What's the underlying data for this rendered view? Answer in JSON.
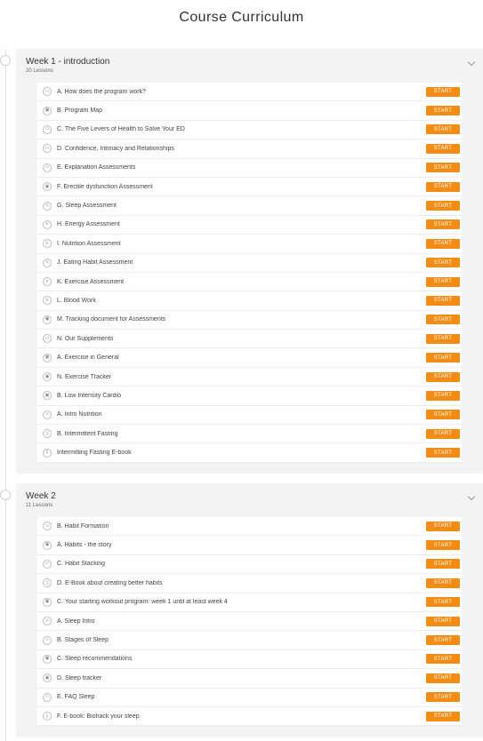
{
  "page_title": "Course Curriculum",
  "colors": {
    "accent": "#f28c14",
    "panel": "#f3f3f3"
  },
  "weeks": [
    {
      "title": "Week 1 - introduction",
      "count": "20 Lessons",
      "lessons": [
        {
          "label": "A. How does the program work?",
          "icon": "video-icon",
          "btn": "START"
        },
        {
          "label": "B. Program Map",
          "icon": "lock-icon",
          "btn": "START"
        },
        {
          "label": "C. The Five Levers of Health to Solve Your ED",
          "icon": "video-icon",
          "btn": "START"
        },
        {
          "label": "D. Confidence, Intimacy and Relationships",
          "icon": "video-icon",
          "btn": "START"
        },
        {
          "label": "E. Explanation Assessments",
          "icon": "video-icon",
          "btn": "START"
        },
        {
          "label": "F. Erectile dysfunction Assessment",
          "icon": "lock-icon",
          "btn": "START"
        },
        {
          "label": "G. Sleep Assessment",
          "icon": "document-icon",
          "btn": "START"
        },
        {
          "label": "H. Energy Assessment",
          "icon": "document-icon",
          "btn": "START"
        },
        {
          "label": "I. Nutrition Assessment",
          "icon": "document-icon",
          "btn": "START"
        },
        {
          "label": "J. Eating Habit Assessment",
          "icon": "document-icon",
          "btn": "START"
        },
        {
          "label": "K. Exercise Assessment",
          "icon": "document-icon",
          "btn": "START"
        },
        {
          "label": "L. Blood Work",
          "icon": "document-icon",
          "btn": "START"
        },
        {
          "label": "M. Tracking document for Assessments",
          "icon": "lock-icon",
          "btn": "START"
        },
        {
          "label": "N. Our Supplements",
          "icon": "video-icon",
          "btn": "START"
        },
        {
          "label": "A. Exercise in General",
          "icon": "lock-icon",
          "btn": "START"
        },
        {
          "label": "N. Exercise Tracker",
          "icon": "lock-icon",
          "btn": "START"
        },
        {
          "label": "B. Low Intensity Cardio",
          "icon": "lock-icon",
          "btn": "START"
        },
        {
          "label": "A. Intro Nutrition",
          "icon": "code-icon",
          "btn": "START"
        },
        {
          "label": "B. Intermittent Fasting",
          "icon": "book-icon",
          "btn": "START"
        },
        {
          "label": "Intermitting Fasting E-book",
          "icon": "book-icon",
          "btn": "START"
        }
      ]
    },
    {
      "title": "Week 2",
      "count": "11 Lessons",
      "lessons": [
        {
          "label": "B. Habit Formation",
          "icon": "video-icon",
          "btn": "START"
        },
        {
          "label": "A. Habits - the story",
          "icon": "lock-icon",
          "btn": "START"
        },
        {
          "label": "C. Habit Stacking",
          "icon": "video-icon",
          "btn": "START"
        },
        {
          "label": "D. E-Book about creating better habits",
          "icon": "book-icon",
          "btn": "START"
        },
        {
          "label": "C. Your starting workout program: week 1 until at least week 4",
          "icon": "lock-icon",
          "btn": "START"
        },
        {
          "label": "A. Sleep Intro",
          "icon": "code-icon",
          "btn": "START"
        },
        {
          "label": "B. Stages of Sleep",
          "icon": "code-icon",
          "btn": "START"
        },
        {
          "label": "C. Sleep recommendations",
          "icon": "lock-icon",
          "btn": "START"
        },
        {
          "label": "D. Sleep tracker",
          "icon": "lock-icon",
          "btn": "START"
        },
        {
          "label": "E. FAQ Sleep",
          "icon": "video-icon",
          "btn": "START"
        },
        {
          "label": "F. E-book: Biohack your sleep",
          "icon": "book-icon",
          "btn": "START"
        }
      ]
    }
  ]
}
